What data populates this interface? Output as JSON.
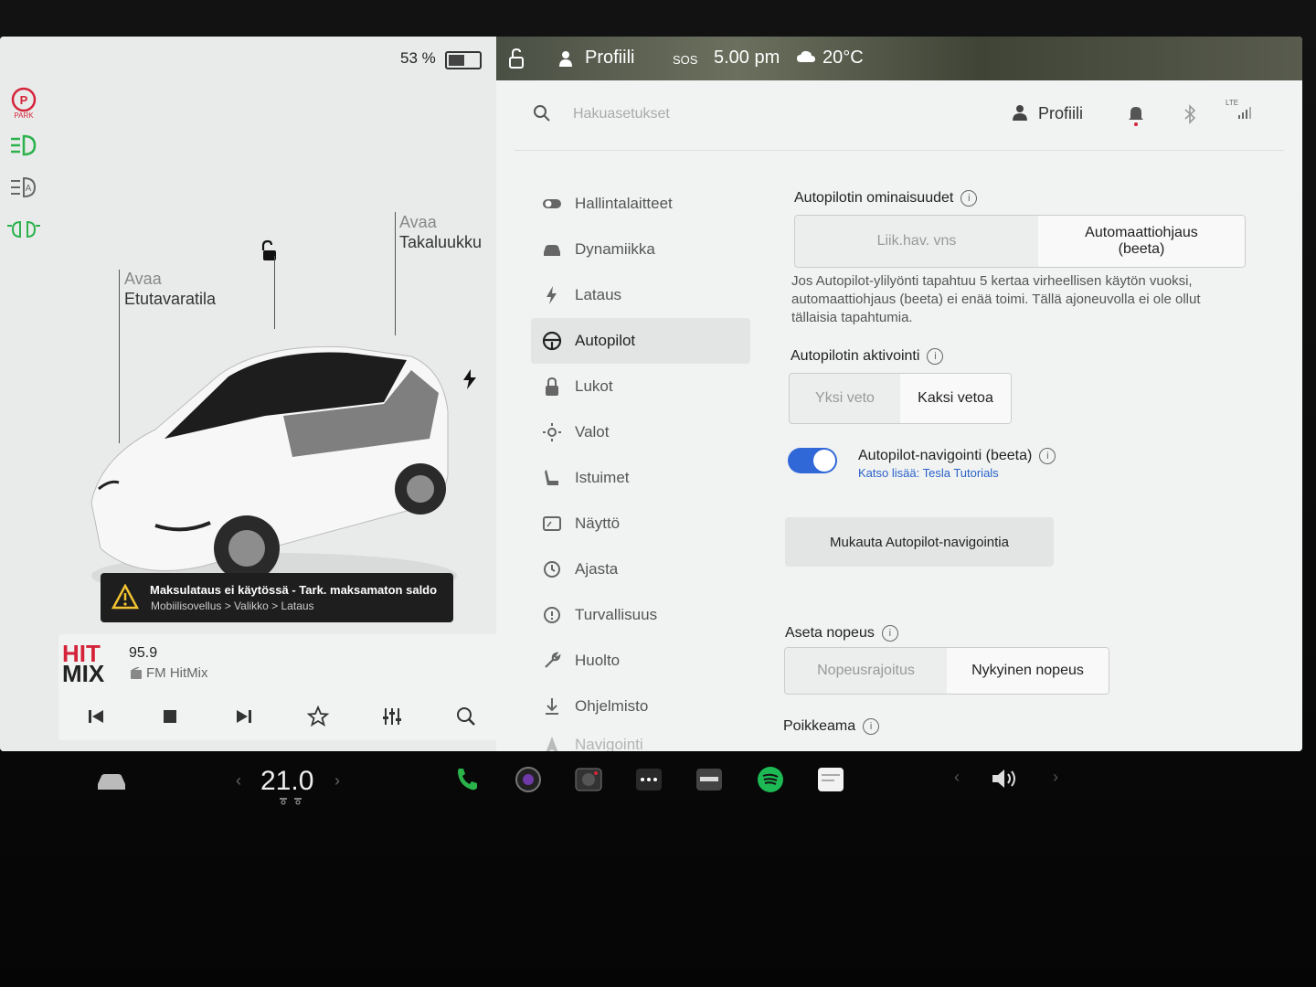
{
  "status": {
    "battery_percent": "53 %",
    "battery_level": 0.53,
    "profile_top": "Profiili",
    "sos": "SOS",
    "time": "5.00 pm",
    "temperature": "20°C"
  },
  "indicators": [
    "park-icon",
    "headlights-icon",
    "auto-headlights-icon",
    "fog-lights-icon"
  ],
  "park_label": "PARK",
  "car_panel": {
    "frunk_action": "Avaa",
    "frunk_label": "Etutavaratila",
    "trunk_action": "Avaa",
    "trunk_label": "Takaluukku"
  },
  "warning": {
    "title": "Maksulataus ei käytössä - Tark. maksamaton saldo",
    "path": "Mobiilisovellus > Valikko > Lataus"
  },
  "media": {
    "logo_top": "HIT",
    "logo_bottom": "MIX",
    "frequency": "95.9",
    "station": "FM HitMix"
  },
  "header": {
    "search_placeholder": "Hakuasetukset",
    "profile": "Profiili",
    "lte": "LTE"
  },
  "menu": [
    {
      "label": "Hallintalaitteet",
      "icon": "toggle-icon"
    },
    {
      "label": "Dynamiikka",
      "icon": "car-icon"
    },
    {
      "label": "Lataus",
      "icon": "bolt-icon"
    },
    {
      "label": "Autopilot",
      "icon": "steering-wheel-icon",
      "active": true
    },
    {
      "label": "Lukot",
      "icon": "lock-icon"
    },
    {
      "label": "Valot",
      "icon": "sun-icon"
    },
    {
      "label": "Istuimet",
      "icon": "seat-icon"
    },
    {
      "label": "Näyttö",
      "icon": "display-icon"
    },
    {
      "label": "Ajasta",
      "icon": "schedule-icon"
    },
    {
      "label": "Turvallisuus",
      "icon": "info-icon"
    },
    {
      "label": "Huolto",
      "icon": "wrench-icon"
    },
    {
      "label": "Ohjelmisto",
      "icon": "download-icon"
    },
    {
      "label": "Navigointi",
      "icon": "navigation-icon"
    }
  ],
  "autopilot": {
    "features_title": "Autopilotin ominaisuudet",
    "features_opt1": "Liik.hav. vns",
    "features_opt2": "Automaattiohjaus (beeta)",
    "description": "Jos Autopilot-ylilyönti tapahtuu 5 kertaa virheellisen käytön vuoksi, automaattiohjaus (beeta) ei enää toimi. Tällä ajoneuvolla ei ole ollut tällaisia tapahtumia.",
    "activation_title": "Autopilotin aktivointi",
    "activation_opt1": "Yksi veto",
    "activation_opt2": "Kaksi vetoa",
    "nav_title": "Autopilot-navigointi (beeta)",
    "nav_link_prefix": "Katso lisää:",
    "nav_link": "Tesla Tutorials",
    "customize_button": "Mukauta Autopilot-navigointia",
    "speed_title": "Aseta nopeus",
    "speed_opt1": "Nopeusrajoitus",
    "speed_opt2": "Nykyinen nopeus",
    "offset_title": "Poikkeama"
  },
  "dock": {
    "temperature": "21.0"
  },
  "colors": {
    "accent": "#3068d8",
    "phone_green": "#2ab34a",
    "spotify_green": "#1db954",
    "park_red": "#d5243a",
    "light_green": "#2bb24c"
  }
}
